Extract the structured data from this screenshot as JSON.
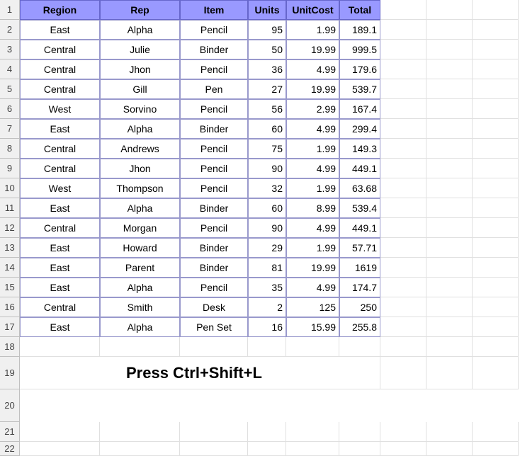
{
  "headers": [
    "Region",
    "Rep",
    "Item",
    "Units",
    "UnitCost",
    "Total"
  ],
  "rows": [
    {
      "n": "1"
    },
    {
      "n": "2",
      "region": "East",
      "rep": "Alpha",
      "item": "Pencil",
      "units": "95",
      "unitcost": "1.99",
      "total": "189.1"
    },
    {
      "n": "3",
      "region": "Central",
      "rep": "Julie",
      "item": "Binder",
      "units": "50",
      "unitcost": "19.99",
      "total": "999.5"
    },
    {
      "n": "4",
      "region": "Central",
      "rep": "Jhon",
      "item": "Pencil",
      "units": "36",
      "unitcost": "4.99",
      "total": "179.6"
    },
    {
      "n": "5",
      "region": "Central",
      "rep": "Gill",
      "item": "Pen",
      "units": "27",
      "unitcost": "19.99",
      "total": "539.7"
    },
    {
      "n": "6",
      "region": "West",
      "rep": "Sorvino",
      "item": "Pencil",
      "units": "56",
      "unitcost": "2.99",
      "total": "167.4"
    },
    {
      "n": "7",
      "region": "East",
      "rep": "Alpha",
      "item": "Binder",
      "units": "60",
      "unitcost": "4.99",
      "total": "299.4"
    },
    {
      "n": "8",
      "region": "Central",
      "rep": "Andrews",
      "item": "Pencil",
      "units": "75",
      "unitcost": "1.99",
      "total": "149.3"
    },
    {
      "n": "9",
      "region": "Central",
      "rep": "Jhon",
      "item": "Pencil",
      "units": "90",
      "unitcost": "4.99",
      "total": "449.1"
    },
    {
      "n": "10",
      "region": "West",
      "rep": "Thompson",
      "item": "Pencil",
      "units": "32",
      "unitcost": "1.99",
      "total": "63.68"
    },
    {
      "n": "11",
      "region": "East",
      "rep": "Alpha",
      "item": "Binder",
      "units": "60",
      "unitcost": "8.99",
      "total": "539.4"
    },
    {
      "n": "12",
      "region": "Central",
      "rep": "Morgan",
      "item": "Pencil",
      "units": "90",
      "unitcost": "4.99",
      "total": "449.1"
    },
    {
      "n": "13",
      "region": "East",
      "rep": "Howard",
      "item": "Binder",
      "units": "29",
      "unitcost": "1.99",
      "total": "57.71"
    },
    {
      "n": "14",
      "region": "East",
      "rep": "Parent",
      "item": "Binder",
      "units": "81",
      "unitcost": "19.99",
      "total": "1619"
    },
    {
      "n": "15",
      "region": "East",
      "rep": "Alpha",
      "item": "Pencil",
      "units": "35",
      "unitcost": "4.99",
      "total": "174.7"
    },
    {
      "n": "16",
      "region": "Central",
      "rep": "Smith",
      "item": "Desk",
      "units": "2",
      "unitcost": "125",
      "total": "250"
    },
    {
      "n": "17",
      "region": "East",
      "rep": "Alpha",
      "item": "Pen Set",
      "units": "16",
      "unitcost": "15.99",
      "total": "255.8"
    }
  ],
  "emptyRows": [
    "18",
    "21",
    "22"
  ],
  "instruction": "Press Ctrl+Shift+L",
  "instructionRowStart": "19",
  "instructionRowEnd": "20"
}
